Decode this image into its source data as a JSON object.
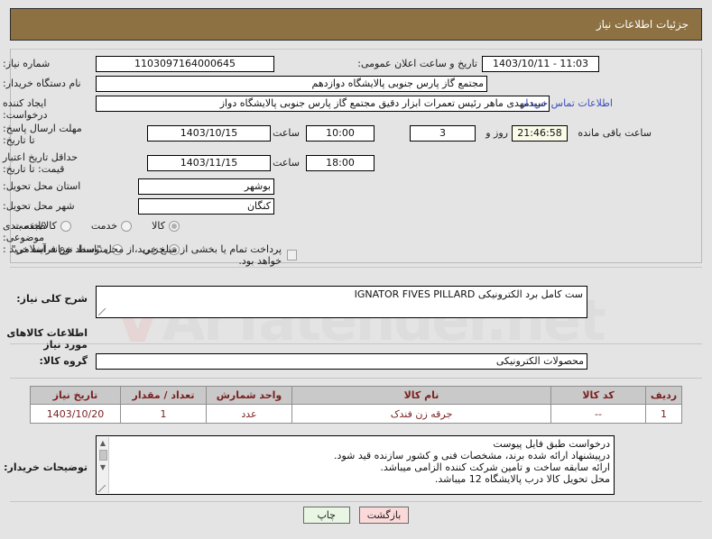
{
  "header": {
    "title": "جزئیات اطلاعات نیاز"
  },
  "watermark": {
    "text": "ArTatender.net",
    "mark": "V"
  },
  "form": {
    "need_number": {
      "label": "شماره نیاز:",
      "value": "1103097164000645"
    },
    "announce_datetime": {
      "label": "تاریخ و ساعت اعلان عمومی:",
      "value": "11:03 - 1403/10/11"
    },
    "buyer_org": {
      "label": "نام دستگاه خریدار:",
      "value": "مجتمع گاز پارس جنوبی  پالایشگاه دوازدهم"
    },
    "requester": {
      "label": "ایجاد کننده درخواست:",
      "value": "سیدمهدی ماهر رئیس تعمرات ابزار دقیق مجتمع گاز پارس جنوبی  پالایشگاه دواز"
    },
    "contact_link": {
      "label": "اطلاعات تماس خریدار"
    },
    "response_deadline": {
      "label": "مهلت ارسال پاسخ: تا تاریخ:",
      "date": "1403/10/15",
      "time_label": "ساعت",
      "time": "10:00",
      "days": "3",
      "days_label": "روز و",
      "remaining": "21:46:58",
      "remaining_label": "ساعت باقی مانده"
    },
    "price_validity": {
      "label": "حداقل تاریخ اعتبار قیمت: تا تاریخ:",
      "date": "1403/11/15",
      "time_label": "ساعت",
      "time": "18:00"
    },
    "province": {
      "label": "استان محل تحویل:",
      "value": "بوشهر"
    },
    "city": {
      "label": "شهر محل تحویل:",
      "value": "کنگان"
    },
    "subject_category": {
      "label": "طبقه بندی موضوعی:",
      "options": [
        {
          "label": "کالا",
          "selected": true
        },
        {
          "label": "خدمت",
          "selected": false
        },
        {
          "label": "کالا/خدمت",
          "selected": false
        }
      ]
    },
    "purchase_process": {
      "label": "نوع فرآیند خرید :",
      "options": [
        {
          "label": "جزیی",
          "selected": true
        },
        {
          "label": "متوسط",
          "selected": false
        }
      ],
      "checkbox": {
        "label": "پرداخت تمام یا بخشی از مبلغ خرید،از محل \"اسناد خزانه اسلامی\" خواهد بود.",
        "checked": false
      }
    },
    "general_description": {
      "label": "شرح کلی نیاز:",
      "value": "ست کامل برد الکترونیکی IGNATOR FIVES PILLARD"
    },
    "goods_section_title": "اطلاعات کالاهای مورد نیاز",
    "goods_group": {
      "label": "گروه کالا:",
      "value": "محصولات الکترونیکی"
    },
    "buyer_notes": {
      "label": "توضیحات خریدار:",
      "lines": [
        "درخواست طبق فایل پیوست",
        "درپیشنهاد ارائه شده برند، مشخصات فنی و کشور سازنده قید شود.",
        "ارائه سابقه ساخت و تامین شرکت کننده الزامی میباشد.",
        "محل تحویل کالا درب پالایشگاه 12 میباشد."
      ]
    }
  },
  "goods_table": {
    "columns": [
      "ردیف",
      "کد کالا",
      "نام کالا",
      "واحد شمارش",
      "تعداد / مقدار",
      "تاریخ نیاز"
    ],
    "rows": [
      {
        "row_no": "1",
        "code": "--",
        "name": "جرقه زن فندک",
        "unit": "عدد",
        "qty": "1",
        "need_date": "1403/10/20"
      }
    ]
  },
  "buttons": {
    "print": "چاپ",
    "back": "بازگشت"
  }
}
